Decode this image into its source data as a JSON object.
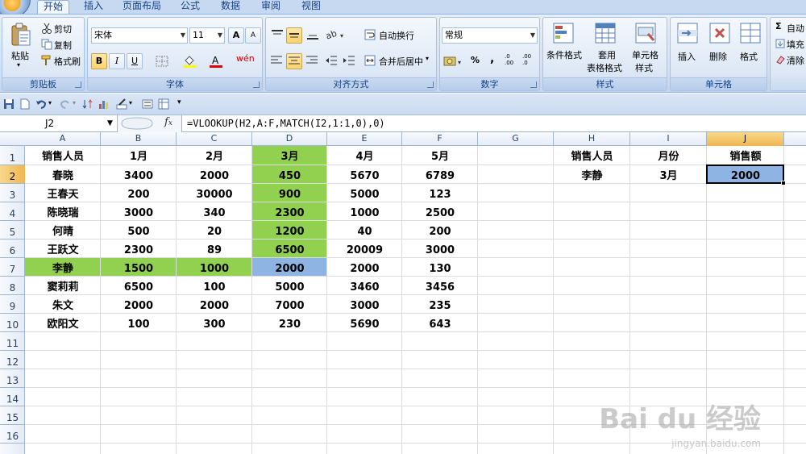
{
  "ribbon": {
    "tabs": [
      "开始",
      "插入",
      "页面布局",
      "公式",
      "数据",
      "审阅",
      "视图"
    ],
    "clipboard": {
      "title": "剪贴板",
      "paste": "粘贴",
      "cut": "剪切",
      "copy": "复制",
      "format_painter": "格式刷"
    },
    "font": {
      "title": "字体",
      "name": "宋体",
      "size": "11",
      "bold": "B",
      "italic": "I",
      "underline": "U",
      "phonetic": "wén",
      "grow": "A",
      "shrink": "A"
    },
    "alignment": {
      "title": "对齐方式",
      "wrap": "自动换行",
      "merge": "合并后居中"
    },
    "number": {
      "title": "数字",
      "format": "常规",
      "percent": "%",
      "comma": ",",
      "inc": ".0 .00",
      "dec": ".00 .0"
    },
    "styles": {
      "title": "样式",
      "conditional": "条件格式",
      "table_1": "套用",
      "table_2": "表格格式",
      "cell_1": "单元格",
      "cell_2": "样式"
    },
    "cells": {
      "title": "单元格",
      "insert": "插入",
      "delete": "删除",
      "format": "格式"
    },
    "editing": {
      "autosum": "自动",
      "fill": "填充",
      "clear": "清除"
    }
  },
  "formula_bar": {
    "name_box": "J2",
    "formula": "=VLOOKUP(H2,A:F,MATCH(I2,1:1,0),0)"
  },
  "sheet": {
    "columns": [
      "A",
      "B",
      "C",
      "D",
      "E",
      "F",
      "G",
      "H",
      "I",
      "J"
    ],
    "rows": [
      "1",
      "2",
      "3",
      "4",
      "5",
      "6",
      "7",
      "8",
      "9",
      "10",
      "11",
      "12",
      "13",
      "14",
      "15",
      "16"
    ],
    "table": [
      [
        "销售人员",
        "1月",
        "2月",
        "3月",
        "4月",
        "5月"
      ],
      [
        "春晓",
        "3400",
        "2000",
        "450",
        "5670",
        "6789"
      ],
      [
        "王春天",
        "200",
        "30000",
        "900",
        "5000",
        "123"
      ],
      [
        "陈晓瑞",
        "3000",
        "340",
        "2300",
        "1000",
        "2500"
      ],
      [
        "何晴",
        "500",
        "20",
        "1200",
        "40",
        "200"
      ],
      [
        "王跃文",
        "2300",
        "89",
        "6500",
        "20009",
        "3000"
      ],
      [
        "李静",
        "1500",
        "1000",
        "2000",
        "2000",
        "130"
      ],
      [
        "窦莉莉",
        "6500",
        "100",
        "5000",
        "3460",
        "3456"
      ],
      [
        "朱文",
        "2000",
        "2000",
        "7000",
        "3000",
        "235"
      ],
      [
        "欧阳文",
        "100",
        "300",
        "230",
        "5690",
        "643"
      ]
    ],
    "lookup": {
      "headers": [
        "销售人员",
        "月份",
        "销售额"
      ],
      "values": [
        "李静",
        "3月",
        "2000"
      ]
    },
    "colors": {
      "highlight_green": "#92d050",
      "highlight_blue": "#8db4e2"
    }
  },
  "watermark": {
    "main": "Bai du 经验",
    "sub": "jingyan.baidu.com"
  }
}
